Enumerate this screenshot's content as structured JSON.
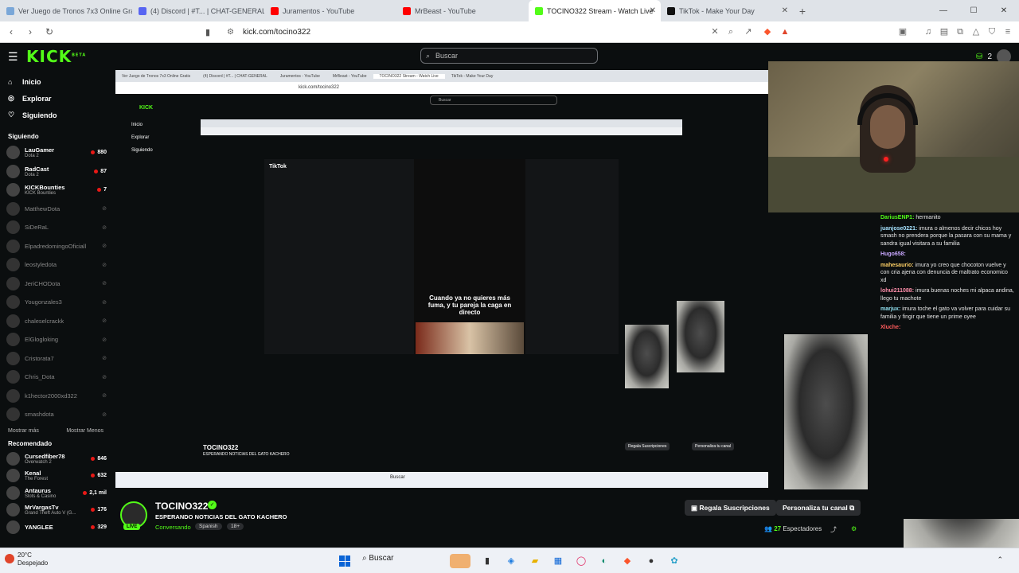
{
  "browser": {
    "tabs": [
      {
        "label": "Ver Juego de Tronos 7x3 Online Gratis",
        "color": "#7aa7d8"
      },
      {
        "label": "(4) Discord | #T... | CHAT-GENERAL",
        "color": "#5865f2"
      },
      {
        "label": "Juramentos - YouTube",
        "color": "#ff0000"
      },
      {
        "label": "MrBeast - YouTube",
        "color": "#ff0000"
      },
      {
        "label": "TOCINO322 Stream - Watch Live",
        "color": "#53fc18"
      },
      {
        "label": "TikTok - Make Your Day",
        "color": "#111111"
      }
    ],
    "url": "kick.com/tocino322"
  },
  "header": {
    "logo": "KICK",
    "logo_sup": "BETA",
    "search_placeholder": "Buscar",
    "points": "2"
  },
  "sidebar": {
    "nav": [
      {
        "label": "Inicio",
        "icon": "home-icon"
      },
      {
        "label": "Explorar",
        "icon": "compass-icon"
      },
      {
        "label": "Siguiendo",
        "icon": "heart-icon"
      }
    ],
    "following_title": "Siguiendo",
    "following": [
      {
        "name": "LauGamer",
        "game": "Dota 2",
        "viewers": "880",
        "live": true
      },
      {
        "name": "RadCast",
        "game": "Dota 2",
        "viewers": "87",
        "live": true
      },
      {
        "name": "KICKBounties",
        "game": "KICK Bounties",
        "viewers": "7",
        "live": true
      },
      {
        "name": "MatthewDota",
        "live": false
      },
      {
        "name": "SiDeRaL",
        "live": false
      },
      {
        "name": "ElpadredomingoOficiall",
        "live": false
      },
      {
        "name": "leostyledota",
        "live": false
      },
      {
        "name": "JeriCHODota",
        "live": false
      },
      {
        "name": "Yougonzales3",
        "live": false
      },
      {
        "name": "chaleselcrackk",
        "live": false
      },
      {
        "name": "ElGlogloking",
        "live": false
      },
      {
        "name": "Cristorata7",
        "live": false
      },
      {
        "name": "Chris_Dota",
        "live": false
      },
      {
        "name": "k1hector2000xd322",
        "live": false
      },
      {
        "name": "smashdota",
        "live": false
      }
    ],
    "show_more": "Mostrar más",
    "show_less": "Mostrar Menos",
    "recommended_title": "Recomendado",
    "recommended": [
      {
        "name": "Cursedfiber78",
        "game": "Overwatch 2",
        "viewers": "846"
      },
      {
        "name": "Kenal",
        "game": "The Forest",
        "viewers": "632"
      },
      {
        "name": "Antaurus",
        "game": "Slots & Casino",
        "viewers": "2,1 mil"
      },
      {
        "name": "MrVargasTv",
        "game": "Grand Theft Auto V (G...",
        "viewers": "176"
      },
      {
        "name": "YANGLEE",
        "game": "",
        "viewers": "329"
      }
    ]
  },
  "nested": {
    "tiktok_caption": "Cuando ya no quieres más fuma, y tu pareja la caga en directo",
    "tiktok_label": "TikTok"
  },
  "chat": {
    "messages": [
      {
        "user": "DariusENP1:",
        "text": "hermanito",
        "color": "#53fc18"
      },
      {
        "user": "juanjose0221:",
        "text": "imura o almenos decir chicos hoy smash no prendera porque la pasara con su mama y sandra igual visitara a su familia",
        "color": "#a6e3ff"
      },
      {
        "user": "Hugo658:",
        "text": "",
        "color": "#c9a7ff"
      },
      {
        "user": "mahesaurio:",
        "text": "imura yo creo que chocoton vuelve y con cria ajena con denuncia de maltrato economico xd",
        "color": "#ffd166"
      },
      {
        "user": "lohui211088:",
        "text": "imura buenas noches mi alpaca andina, llego tu machote",
        "color": "#ff8fab"
      },
      {
        "user": "marjux:",
        "text": "imura toche el gato va volver para cuidar su familia y fingir que tiene un prime oyee",
        "color": "#90e0ef"
      },
      {
        "user": "Xluche:",
        "text": "",
        "color": "#ff5c5c"
      }
    ]
  },
  "stream": {
    "channel": "TOCINO322",
    "live_badge": "LIVE",
    "title": "ESPERANDO NOTICIAS DEL GATO KACHERO",
    "category": "Conversando",
    "tags": [
      "Spanish",
      "18+"
    ],
    "gift_subs": "Regala Suscripciones",
    "customize": "Personaliza tu canal",
    "viewers": "27",
    "viewers_label": "Espectadores"
  },
  "taskbar": {
    "temp": "20°C",
    "weather": "Despejado",
    "search": "Buscar"
  }
}
